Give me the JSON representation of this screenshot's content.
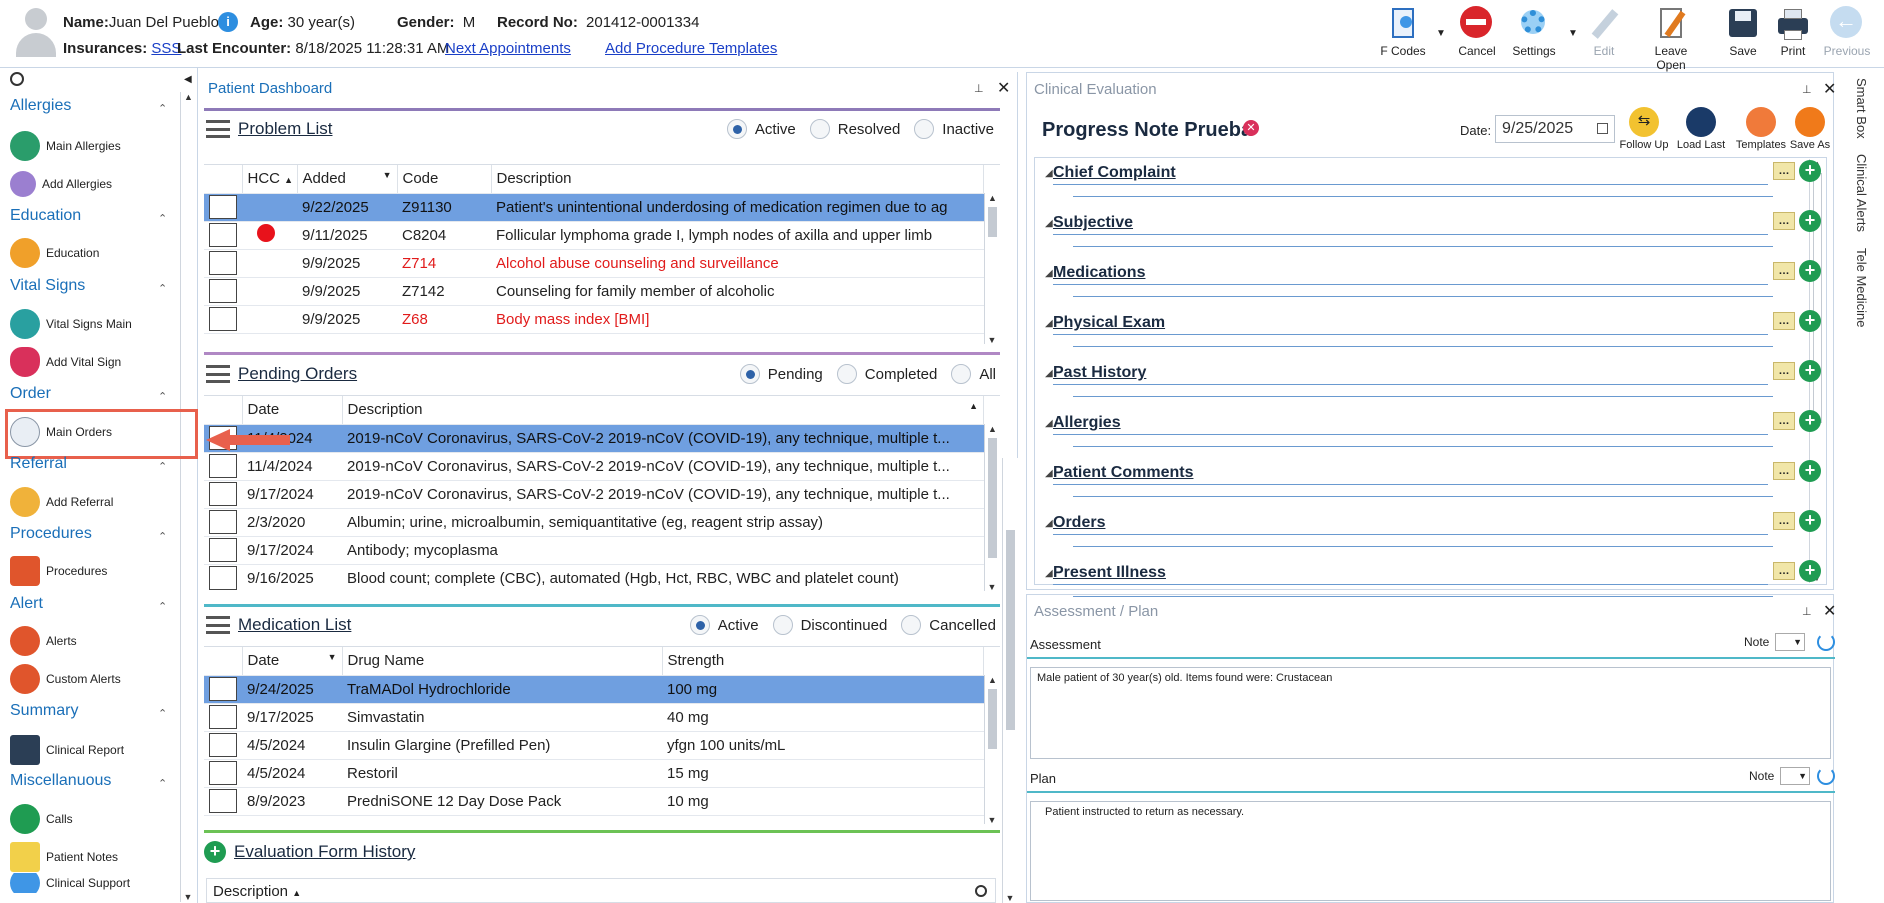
{
  "patient": {
    "name_label": "Name:",
    "name": "Juan Del Pueblo",
    "age_label": "Age:",
    "age": "30 year(s)",
    "gender_label": "Gender:",
    "gender": "M",
    "record_label": "Record No:",
    "record": "201412-0001334",
    "insurances_label": "Insurances:",
    "insurance": "SSS",
    "last_encounter_label": "Last Encounter:",
    "last_encounter": "8/18/2025 11:28:31 AM",
    "next_appointments": "Next Appointments",
    "add_procedure_templates": "Add Procedure Templates"
  },
  "toolbar": {
    "fcodes": "F Codes",
    "cancel": "Cancel",
    "settings": "Settings",
    "edit": "Edit",
    "leave_open": "Leave Open",
    "save": "Save",
    "print": "Print",
    "previous": "Previous"
  },
  "sidebar": {
    "allergies": "Allergies",
    "main_allergies": "Main Allergies",
    "add_allergies": "Add Allergies",
    "education": "Education",
    "education_item": "Education",
    "vital_signs": "Vital Signs",
    "vital_signs_main": "Vital Signs Main",
    "add_vital_sign": "Add Vital Sign",
    "order": "Order",
    "main_orders": "Main Orders",
    "referral": "Referral",
    "add_referral": "Add Referral",
    "procedures": "Procedures",
    "procedures_item": "Procedures",
    "alert": "Alert",
    "alerts": "Alerts",
    "custom_alerts": "Custom Alerts",
    "summary": "Summary",
    "clinical_report": "Clinical Report",
    "miscellaneous": "Miscellanuous",
    "calls": "Calls",
    "patient_notes": "Patient Notes",
    "clinical_support": "Clinical Support"
  },
  "dashboard": {
    "title": "Patient Dashboard",
    "problem_list": {
      "title": "Problem List",
      "filters": [
        "Active",
        "Resolved",
        "Inactive"
      ],
      "columns": [
        "HCC",
        "Added",
        "Code",
        "Description"
      ],
      "rows": [
        {
          "added": "9/22/2025",
          "code": "Z91130",
          "desc": "Patient's unintentional underdosing of medication regimen due to ag",
          "red": false,
          "hcc": false
        },
        {
          "added": "9/11/2025",
          "code": "C8204",
          "desc": "Follicular lymphoma grade I, lymph nodes of axilla and upper limb",
          "red": false,
          "hcc": true
        },
        {
          "added": "9/9/2025",
          "code": "Z714",
          "desc": "Alcohol abuse counseling and surveillance",
          "red": true,
          "hcc": false
        },
        {
          "added": "9/9/2025",
          "code": "Z7142",
          "desc": "Counseling for family member of alcoholic",
          "red": false,
          "hcc": false
        },
        {
          "added": "9/9/2025",
          "code": "Z68",
          "desc": "Body mass index [BMI]",
          "red": true,
          "hcc": false
        }
      ]
    },
    "pending_orders": {
      "title": "Pending Orders",
      "filters": [
        "Pending",
        "Completed",
        "All"
      ],
      "columns": [
        "Date",
        "Description"
      ],
      "rows": [
        {
          "date": "11/4/2024",
          "desc": "2019-nCoV Coronavirus, SARS-CoV-2 2019-nCoV (COVID-19), any technique, multiple t..."
        },
        {
          "date": "11/4/2024",
          "desc": "2019-nCoV Coronavirus, SARS-CoV-2 2019-nCoV (COVID-19), any technique, multiple t..."
        },
        {
          "date": "9/17/2024",
          "desc": "2019-nCoV Coronavirus, SARS-CoV-2 2019-nCoV (COVID-19), any technique, multiple t..."
        },
        {
          "date": "2/3/2020",
          "desc": "Albumin; urine, microalbumin, semiquantitative (eg, reagent strip assay)"
        },
        {
          "date": "9/17/2024",
          "desc": "Antibody; mycoplasma"
        },
        {
          "date": "9/16/2025",
          "desc": "Blood count; complete (CBC), automated (Hgb, Hct, RBC, WBC and platelet count)"
        }
      ]
    },
    "medication_list": {
      "title": "Medication List",
      "filters": [
        "Active",
        "Discontinued",
        "Cancelled"
      ],
      "columns": [
        "Date",
        "Drug Name",
        "Strength"
      ],
      "rows": [
        {
          "date": "9/24/2025",
          "drug": "TraMADol Hydrochloride",
          "strength": "100 mg"
        },
        {
          "date": "9/17/2025",
          "drug": "Simvastatin",
          "strength": "40 mg"
        },
        {
          "date": "4/5/2024",
          "drug": "Insulin Glargine (Prefilled Pen)",
          "strength": "yfgn 100 units/mL"
        },
        {
          "date": "4/5/2024",
          "drug": "Restoril",
          "strength": "15 mg"
        },
        {
          "date": "8/9/2023",
          "drug": "PredniSONE 12 Day Dose Pack",
          "strength": "10 mg"
        }
      ]
    },
    "evaluation_history": {
      "title": "Evaluation Form History",
      "column": "Description"
    }
  },
  "clinical_eval": {
    "title": "Clinical Evaluation",
    "note_title": "Progress Note Prueba",
    "date_label": "Date:",
    "date": "9/25/2025",
    "actions": [
      "Follow Up",
      "Load Last",
      "Templates",
      "Save As"
    ],
    "sections": [
      "Chief Complaint",
      "Subjective",
      "Medications",
      "Physical Exam",
      "Past History",
      "Allergies",
      "Patient Comments",
      "Orders",
      "Present Illness"
    ]
  },
  "assessment_plan": {
    "title": "Assessment / Plan",
    "assessment_label": "Assessment",
    "note_label": "Note",
    "assessment_text": "Male patient of 30 year(s) old. Items found were:  Crustacean",
    "plan_label": "Plan",
    "plan_text": "Patient instructed to return as necessary."
  },
  "right_tabs": [
    "Smart Box",
    "Clinical Alerts",
    "Tele Medicine"
  ],
  "colors": {
    "accent": "#1a6fb8",
    "selection": "#6f9fe0",
    "highlight_box": "#e8604c",
    "add_green": "#1f9c52"
  }
}
